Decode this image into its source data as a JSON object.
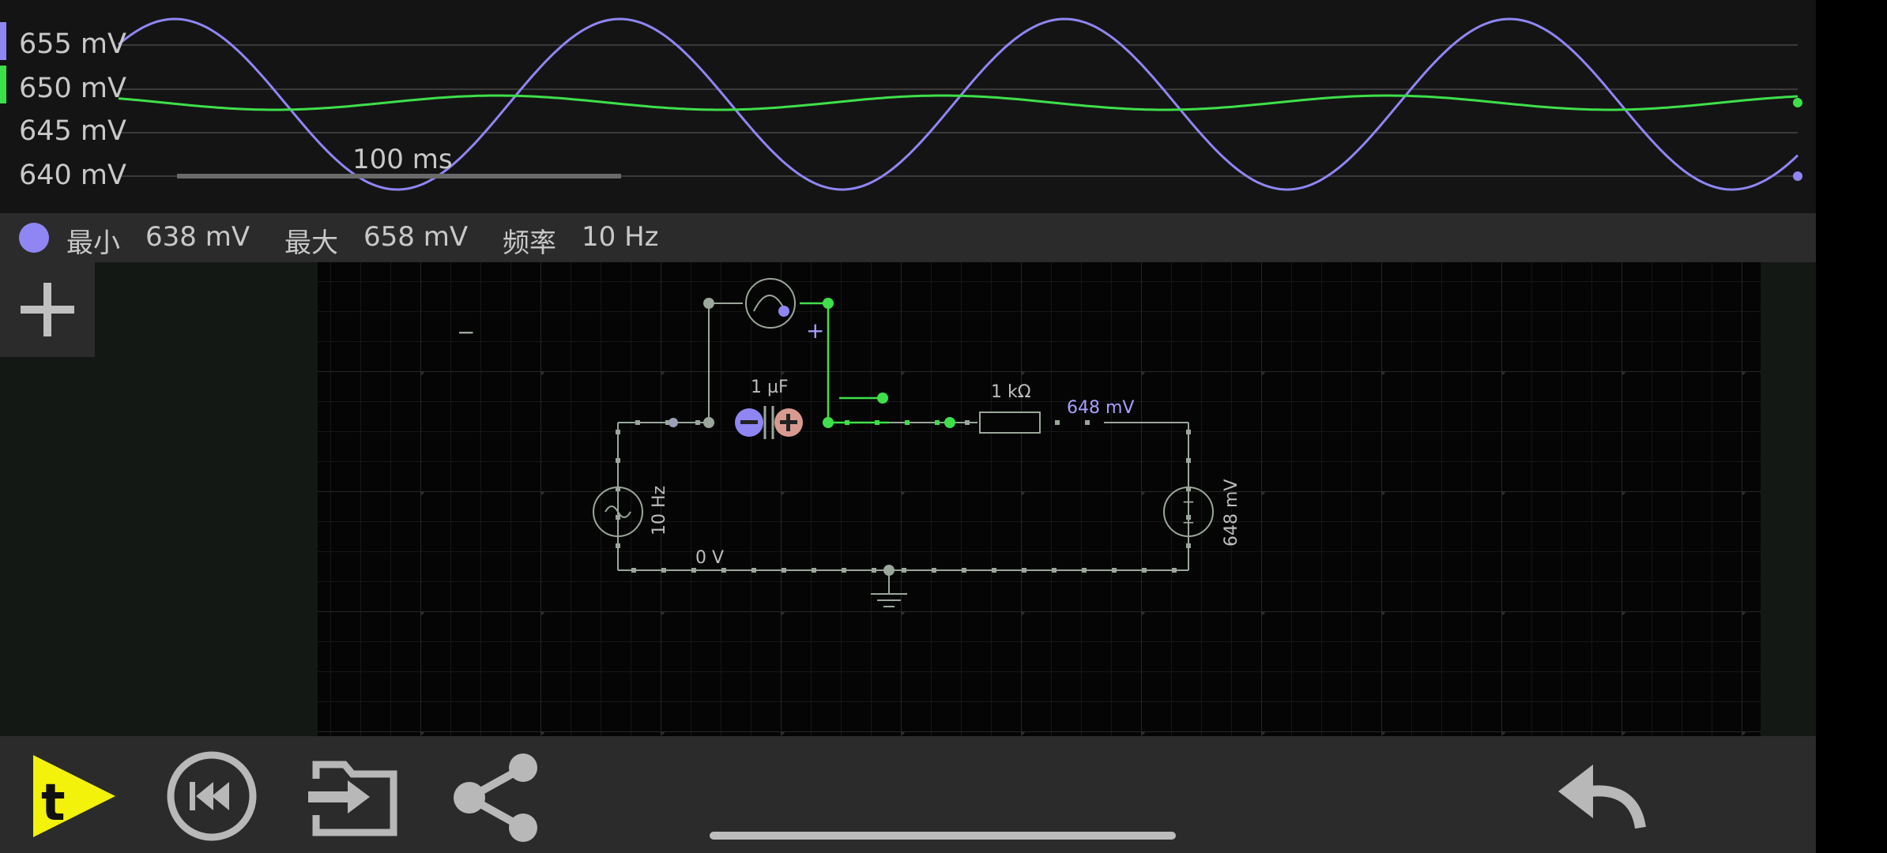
{
  "scope": {
    "y_labels": [
      "655 mV",
      "650 mV",
      "645 mV",
      "640 mV"
    ],
    "time_scale": "100 ms",
    "series_colors": {
      "capacitor": "#8f86f4",
      "node": "#3ee04a"
    }
  },
  "stats": {
    "min_label": "最小",
    "min_value": "638 mV",
    "max_label": "最大",
    "max_value": "658 mV",
    "freq_label": "频率",
    "freq_value": "10 Hz"
  },
  "circuit": {
    "capacitor_label": "1 µF",
    "resistor_label": "1 kΩ",
    "node_voltage_label": "648 mV",
    "ac_source_label": "10 Hz",
    "dc_source_label": "648 mV",
    "ground_label": "0 V",
    "scope_minus": "−",
    "scope_plus": "+"
  },
  "toolbar": {
    "play_icon": "play-t-icon",
    "reset_icon": "rewind-icon",
    "open_icon": "open-file-icon",
    "share_icon": "share-icon",
    "undo_icon": "undo-icon",
    "add_icon": "plus-icon"
  }
}
